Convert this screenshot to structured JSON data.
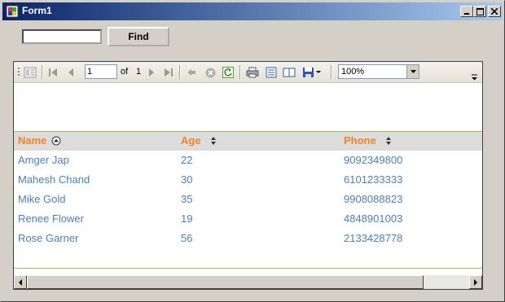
{
  "window": {
    "title": "Form1"
  },
  "form": {
    "search_value": "",
    "find_label": "Find"
  },
  "toolbar": {
    "page": "1",
    "of_label": "of",
    "total_pages": "1",
    "zoom": "100%"
  },
  "report": {
    "columns": [
      "Name",
      "Age",
      "Phone"
    ],
    "rows": [
      {
        "name": "Amger Jap",
        "age": "22",
        "phone": "9092349800"
      },
      {
        "name": "Mahesh Chand",
        "age": "30",
        "phone": "6101233333"
      },
      {
        "name": "Mike Gold",
        "age": "35",
        "phone": "9908088823"
      },
      {
        "name": "Renee Flower",
        "age": "19",
        "phone": "4848901003"
      },
      {
        "name": "Rose Garner",
        "age": "56",
        "phone": "2133428778"
      }
    ]
  },
  "colors": {
    "header_text": "#f58220",
    "cell_text": "#4a7fc1",
    "rule": "#9cc24e",
    "title_start": "#0a246a"
  }
}
